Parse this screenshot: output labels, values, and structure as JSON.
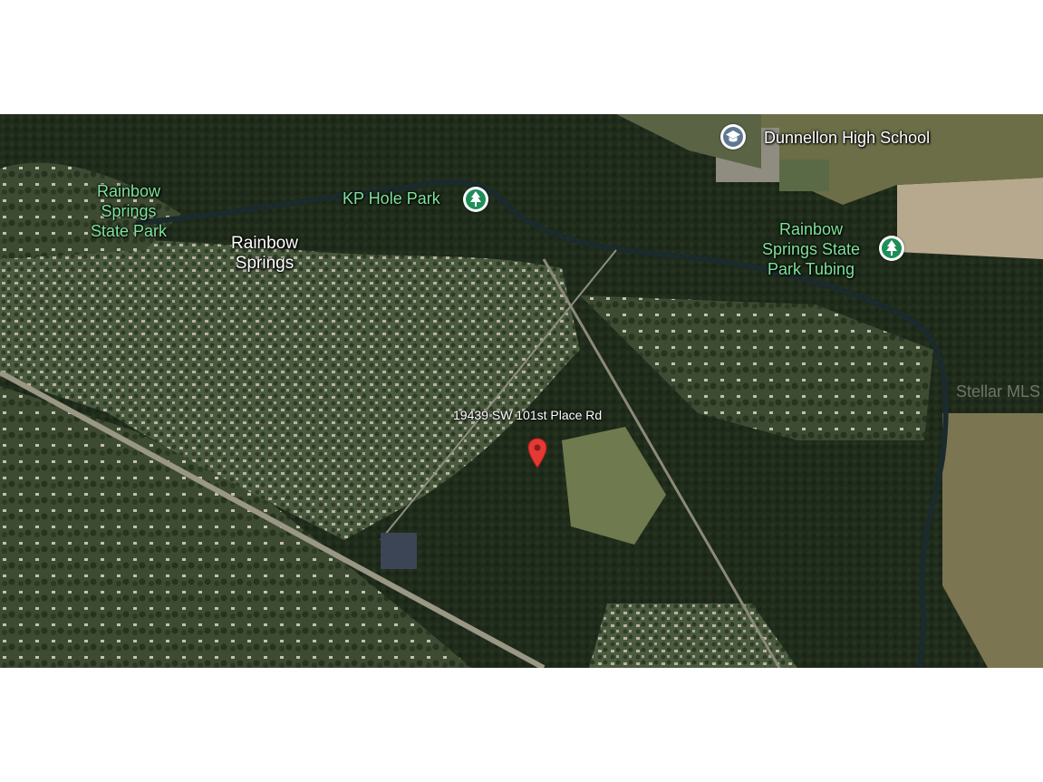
{
  "map": {
    "colors": {
      "forest": "#1f2a1b",
      "neighborhood": "#4a5a3d",
      "river": "#1c2a2a",
      "park_label": "#7ee39a",
      "park_icon": "#1e8e5a",
      "school_icon": "#5f7892",
      "pin": "#e53935"
    },
    "labels": {
      "rainbow_springs_park": "Rainbow\nSprings\nState Park",
      "kp_hole_park": "KP Hole Park",
      "rainbow_springs": "Rainbow\nSprings",
      "dunnellon_high_school": "Dunnellon High School",
      "tubing": "Rainbow\nSprings State\nPark Tubing",
      "address": "19439 SW 101st Place Rd",
      "watermark": "Stellar MLS"
    },
    "icons": {
      "park": "tree-icon",
      "school": "school-icon",
      "pin": "location-pin-icon"
    }
  }
}
